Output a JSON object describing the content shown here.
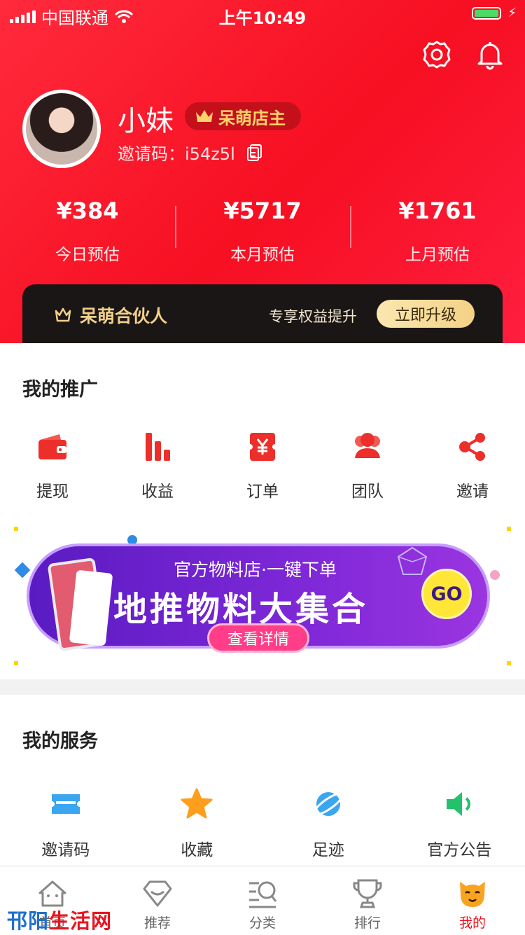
{
  "status_bar": {
    "carrier": "中国联通",
    "time": "上午10:49"
  },
  "profile": {
    "name": "小妹",
    "badge": "呆萌店主",
    "invite_label": "邀请码：",
    "invite_code": "i54z5l"
  },
  "stats": [
    {
      "value": "¥384",
      "label": "今日预估"
    },
    {
      "value": "¥5717",
      "label": "本月预估"
    },
    {
      "value": "¥1761",
      "label": "上月预估"
    }
  ],
  "partner": {
    "title": "呆萌合伙人",
    "subtitle": "专享权益提升",
    "button": "立即升级"
  },
  "promotion": {
    "title": "我的推广",
    "items": [
      {
        "label": "提现",
        "icon": "wallet-icon"
      },
      {
        "label": "收益",
        "icon": "bar-chart-icon"
      },
      {
        "label": "订单",
        "icon": "order-icon"
      },
      {
        "label": "团队",
        "icon": "team-icon"
      },
      {
        "label": "邀请",
        "icon": "share-icon"
      }
    ]
  },
  "banner": {
    "subtitle": "官方物料店·一键下单",
    "headline": "地推物料大集合",
    "go": "GO",
    "button": "查看详情"
  },
  "services": {
    "title": "我的服务",
    "items": [
      {
        "label": "邀请码",
        "icon": "ticket-icon"
      },
      {
        "label": "收藏",
        "icon": "star-icon"
      },
      {
        "label": "足迹",
        "icon": "planet-icon"
      },
      {
        "label": "官方公告",
        "icon": "speaker-icon"
      }
    ]
  },
  "tabs": [
    {
      "label": "首页",
      "icon": "home-icon"
    },
    {
      "label": "推荐",
      "icon": "diamond-icon"
    },
    {
      "label": "分类",
      "icon": "category-search-icon"
    },
    {
      "label": "排行",
      "icon": "trophy-icon"
    },
    {
      "label": "我的",
      "icon": "cat-face-icon"
    }
  ],
  "active_tab": "我的",
  "watermark": {
    "part1": "邗阳",
    "part2": "生活网"
  },
  "colors": {
    "header_red": "#f70f22",
    "accent_red": "#e8141e",
    "gold": "#f2d089",
    "banner_purple": "#6a21c9"
  }
}
